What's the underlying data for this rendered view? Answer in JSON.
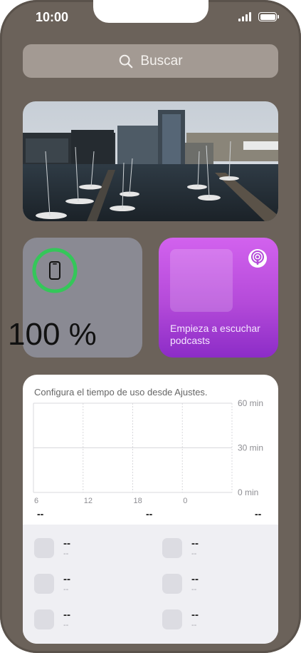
{
  "status_bar": {
    "time": "10:00"
  },
  "search": {
    "label": "Buscar"
  },
  "photo_widget": {
    "subject": "harbor-with-sailboats-and-office-buildings"
  },
  "battery_widget": {
    "percent_text": "100 %",
    "level": 1.0,
    "ring_color": "#34c759"
  },
  "podcast_widget": {
    "text": "Empieza a escuchar podcasts",
    "accent": "#b44ad9"
  },
  "screen_time_widget": {
    "title": "Configura el tiempo de uso desde Ajustes.",
    "totals": [
      "--",
      "--",
      "--"
    ],
    "apps": [
      {
        "name": "--",
        "time": "--"
      },
      {
        "name": "--",
        "time": "--"
      },
      {
        "name": "--",
        "time": "--"
      },
      {
        "name": "--",
        "time": "--"
      },
      {
        "name": "--",
        "time": "--"
      },
      {
        "name": "--",
        "time": "--"
      }
    ],
    "chart_data": {
      "type": "bar",
      "x_ticks": [
        "6",
        "12",
        "18",
        "0"
      ],
      "y_ticks": [
        "60 min",
        "30 min",
        "0 min"
      ],
      "ylim": [
        0,
        60
      ],
      "values": [],
      "grid": true
    }
  }
}
